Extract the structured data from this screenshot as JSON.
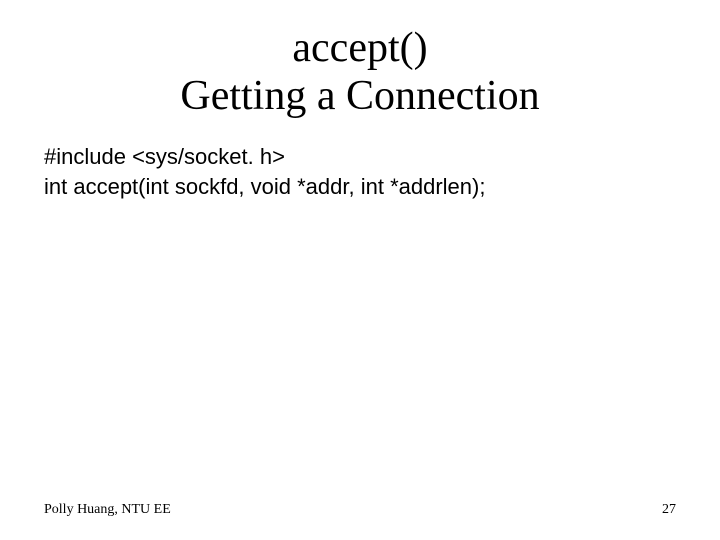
{
  "title": {
    "line1": "accept()",
    "line2": "Getting a Connection"
  },
  "body": {
    "line1": "#include <sys/socket. h>",
    "line2": "int accept(int sockfd, void *addr, int *addrlen);"
  },
  "footer": {
    "author": "Polly Huang, NTU EE",
    "page": "27"
  }
}
